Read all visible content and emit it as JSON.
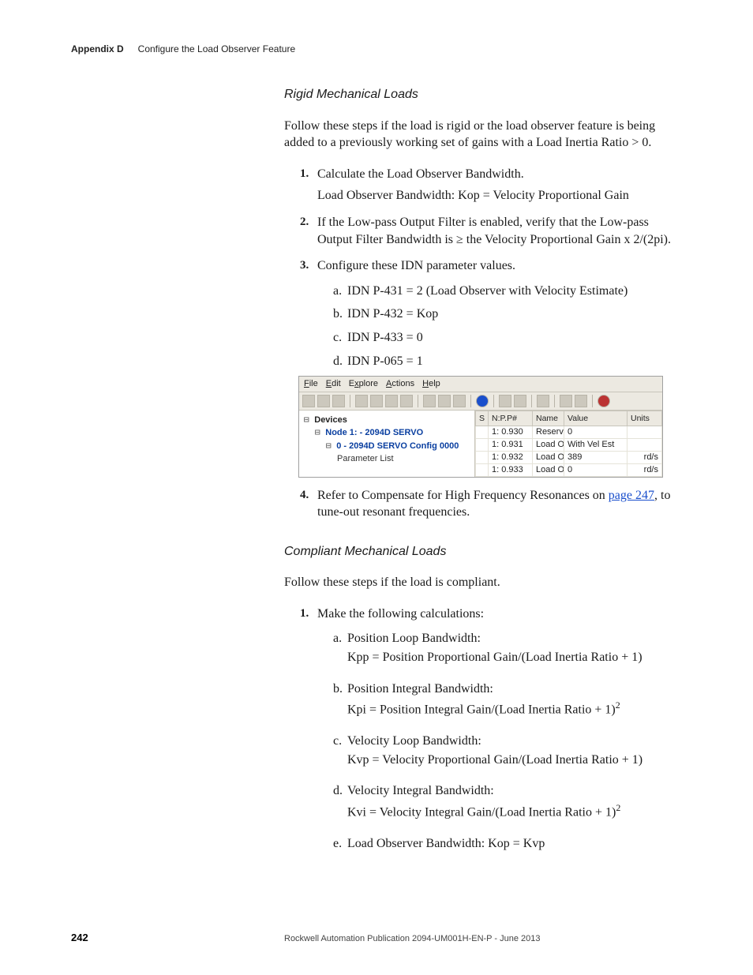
{
  "header": {
    "appendix": "Appendix D",
    "chapter": "Configure the Load Observer Feature"
  },
  "section1": {
    "title": "Rigid Mechanical Loads",
    "intro": "Follow these steps if the load is rigid or the load observer feature is being added to a previously working set of gains with a Load Inertia Ratio > 0.",
    "steps": {
      "s1": {
        "num": "1.",
        "text": "Calculate the Load Observer Bandwidth.",
        "sub": "Load Observer Bandwidth: Kop = Velocity Proportional Gain"
      },
      "s2": {
        "num": "2.",
        "text": "If the Low-pass Output Filter is enabled, verify that the Low-pass Output Filter Bandwidth is ≥ the Velocity Proportional Gain x 2/(2pi)."
      },
      "s3": {
        "num": "3.",
        "text": "Configure these IDN parameter values.",
        "items": {
          "a": {
            "al": "a.",
            "t": "IDN P-431 = 2 (Load Observer with Velocity Estimate)"
          },
          "b": {
            "al": "b.",
            "t": "IDN P-432 = Kop"
          },
          "c": {
            "al": "c.",
            "t": "IDN P-433 = 0"
          },
          "d": {
            "al": "d.",
            "t": "IDN P-065 = 1"
          }
        }
      },
      "s4": {
        "num": "4.",
        "pre": "Refer to Compensate for High Frequency Resonances on ",
        "link": "page 247",
        "post": ", to tune-out resonant frequencies."
      }
    }
  },
  "figure": {
    "menu": {
      "file": "File",
      "edit": "Edit",
      "explore": "Explore",
      "actions": "Actions",
      "help": "Help"
    },
    "tree": {
      "root": "Devices",
      "node1": "Node 1: - 2094D SERVO",
      "node2": "0  - 2094D SERVO Config 0000",
      "leaf": "Parameter List"
    },
    "columns": {
      "s": "S",
      "npp": "N:P.P#",
      "name": "Name",
      "value": "Value",
      "units": "Units"
    },
    "rows": [
      {
        "npp": "1: 0.930",
        "name": "Reserved",
        "value": "0",
        "units": ""
      },
      {
        "npp": "1: 0.931",
        "name": "Load Obs Config",
        "value": "With Vel Est",
        "units": ""
      },
      {
        "npp": "1: 0.932",
        "name": "Load Obs Bw",
        "value": "389",
        "units": "rd/s"
      },
      {
        "npp": "1: 0.933",
        "name": "Load Obs Int Bw",
        "value": "0",
        "units": "rd/s"
      }
    ]
  },
  "section2": {
    "title": "Compliant Mechanical Loads",
    "intro": "Follow these steps if the load is compliant.",
    "steps": {
      "s1": {
        "num": "1.",
        "text": "Make the following calculations:",
        "items": {
          "a": {
            "al": "a.",
            "head": "Position Loop Bandwidth:",
            "body": "Kpp = Position Proportional Gain/(Load Inertia Ratio + 1)"
          },
          "b": {
            "al": "b.",
            "head": "Position Integral Bandwidth:",
            "body_pre": "Kpi = Position Integral Gain/(Load Inertia Ratio + 1)",
            "exp": "2"
          },
          "c": {
            "al": "c.",
            "head": "Velocity Loop Bandwidth:",
            "body": "Kvp = Velocity Proportional Gain/(Load Inertia Ratio + 1)"
          },
          "d": {
            "al": "d.",
            "head": "Velocity Integral Bandwidth:",
            "body_pre": "Kvi = Velocity Integral Gain/(Load Inertia Ratio + 1)",
            "exp": "2"
          },
          "e": {
            "al": "e.",
            "head": "Load Observer Bandwidth: Kop = Kvp"
          }
        }
      }
    }
  },
  "footer": {
    "page": "242",
    "pub": "Rockwell Automation Publication 2094-UM001H-EN-P - June 2013"
  }
}
